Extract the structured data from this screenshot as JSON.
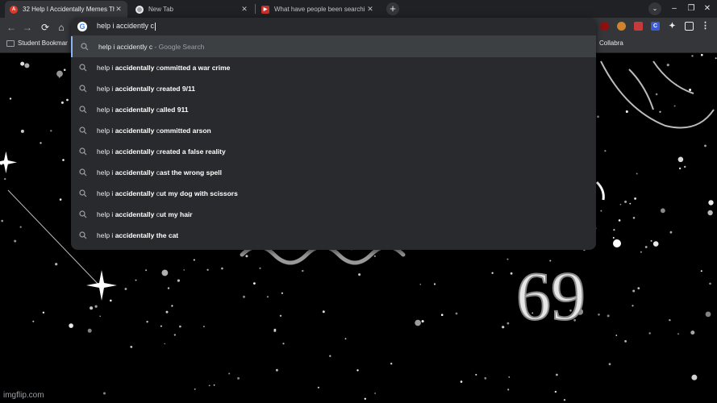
{
  "tabs": [
    {
      "title": "32 Help I Accidentally Memes Th",
      "favicon": "imgflip-icon",
      "active": true
    },
    {
      "title": "New Tab",
      "favicon": "chrome-icon",
      "active": false
    },
    {
      "title": "What have people been searchi",
      "favicon": "youtube-icon",
      "active": false
    }
  ],
  "new_tab_symbol": "+",
  "window": {
    "tab_search": "⌄",
    "minimize": "–",
    "restore": "❐",
    "close": "✕"
  },
  "toolbar": {
    "back": "←",
    "forward": "→",
    "reload": "⟳",
    "home": "⌂"
  },
  "extensions": [
    {
      "name": "puzzle-extension-icon",
      "label": "",
      "color": "#8e0f0f"
    },
    {
      "name": "colorful-extension-icon",
      "label": "",
      "color": "#d1822b"
    },
    {
      "name": "magnet-extension-icon",
      "label": "",
      "color": "#c53a3a"
    },
    {
      "name": "c-extension-icon",
      "label": "C",
      "color": "#3b5ad6"
    },
    {
      "name": "extensions-puzzle-icon",
      "label": "",
      "color": "#5f6368"
    },
    {
      "name": "sidebar-icon",
      "label": "",
      "color": "#5f6368"
    },
    {
      "name": "more-menu-icon",
      "label": "⋮",
      "color": "#35363a"
    }
  ],
  "bookmarks": {
    "left": "Student Bookmar",
    "right": "Collabra"
  },
  "omnibox": {
    "query": "help i accidently c",
    "suggestions": [
      {
        "prefix": "help i accidently c",
        "bold": "",
        "suffix": " - Google Search",
        "type": "query"
      },
      {
        "prefix": "help i ",
        "bold": "accidentally",
        "mid": " c",
        "rest": "ommitted a war crime"
      },
      {
        "prefix": "help i ",
        "bold": "accidentally",
        "mid": " c",
        "rest": "reated 9/11"
      },
      {
        "prefix": "help i ",
        "bold": "accidentally",
        "mid": " c",
        "rest": "alled 911"
      },
      {
        "prefix": "help i ",
        "bold": "accidentally",
        "mid": " c",
        "rest": "ommitted arson"
      },
      {
        "prefix": "help i ",
        "bold": "accidentally",
        "mid": " c",
        "rest": "reated a false reality"
      },
      {
        "prefix": "help i ",
        "bold": "accidentally",
        "mid": " c",
        "rest": "ast the wrong spell"
      },
      {
        "prefix": "help i ",
        "bold": "accidentally",
        "mid": " c",
        "rest": "ut my dog with scissors"
      },
      {
        "prefix": "help i ",
        "bold": "accidentally",
        "mid": " c",
        "rest": "ut my hair"
      },
      {
        "prefix": "help i ",
        "bold": "accidentally",
        "mid": " ",
        "rest": "the cat"
      }
    ]
  },
  "background": {
    "zodiac_number": "69"
  },
  "watermark": "imgflip.com"
}
